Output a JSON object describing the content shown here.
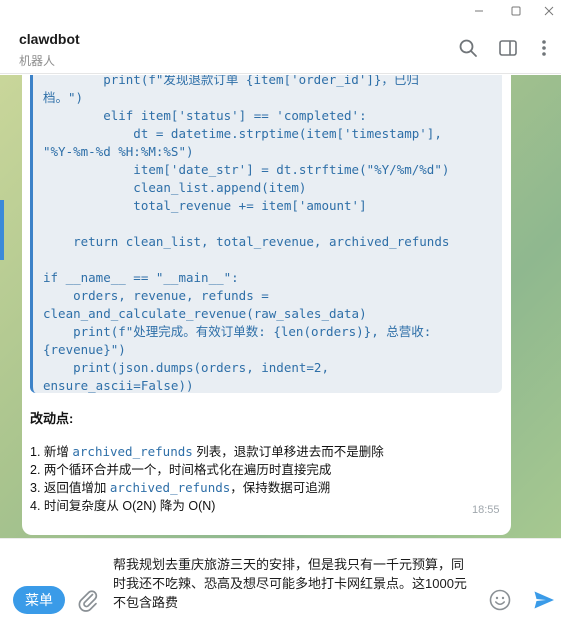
{
  "window": {
    "minimize": "—",
    "maximize": "□",
    "close": "✕"
  },
  "header": {
    "name": "clawdbot",
    "status": "机器人",
    "icons": [
      "search-icon",
      "sidebar-toggle-icon",
      "more-vertical-icon"
    ]
  },
  "message": {
    "code_lines": [
      "        print(f\"发现退款订单 {item['order_id']}，已归",
      "档。\")",
      "        elif item['status'] == 'completed':",
      "            dt = datetime.strptime(item['timestamp'],",
      "\"%Y-%m-%d %H:%M:%S\")",
      "            item['date_str'] = dt.strftime(\"%Y/%m/%d\")",
      "            clean_list.append(item)",
      "            total_revenue += item['amount']",
      "",
      "    return clean_list, total_revenue, archived_refunds",
      "",
      "if __name__ == \"__main__\":",
      "    orders, revenue, refunds =",
      "clean_and_calculate_revenue(raw_sales_data)",
      "    print(f\"处理完成。有效订单数: {len(orders)}, 总营收:",
      "{revenue}\")",
      "    print(json.dumps(orders, indent=2,",
      "ensure_ascii=False))"
    ],
    "section_title": "改动点:",
    "notes": [
      {
        "prefix": "1. 新增 ",
        "code": "archived_refunds",
        "suffix": " 列表，退款订单移进去而不是删除"
      },
      {
        "prefix": "2. 两个循环合并成一个，时间格式化在遍历时直接完成",
        "code": "",
        "suffix": ""
      },
      {
        "prefix": "3. 返回值增加 ",
        "code": "archived_refunds",
        "suffix": "，保持数据可追溯"
      },
      {
        "prefix": "4. 时间复杂度从 O(2N) 降为 O(N)",
        "code": "",
        "suffix": ""
      }
    ],
    "time": "18:55"
  },
  "input": {
    "menu_label": "菜单",
    "draft_text": "帮我规划去重庆旅游三天的安排，但是我只有一千元预算，同时我还不吃辣、恐高及想尽可能多地打卡网红景点。这1000元不包含路费",
    "icons": [
      "attach-icon",
      "emoji-icon",
      "send-icon"
    ]
  },
  "colors": {
    "accent": "#3a9be8",
    "code": "#2e6fa8",
    "code_bg": "#e9eef3"
  }
}
